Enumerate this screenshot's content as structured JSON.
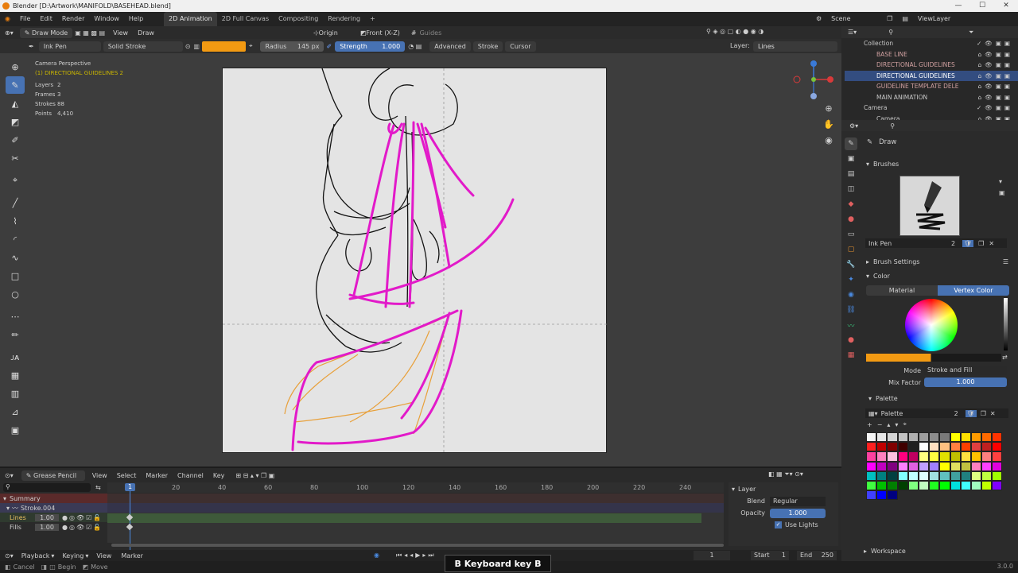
{
  "window": {
    "title": "Blender [D:\\Artwork\\MANIFOLD\\BASEHEAD.blend]",
    "buttons": [
      "—",
      "☐",
      "✕"
    ]
  },
  "menus": [
    "File",
    "Edit",
    "Render",
    "Window",
    "Help"
  ],
  "workspaces": [
    "2D Animation",
    "2D Full Canvas",
    "Compositing",
    "Rendering",
    "+"
  ],
  "scene": {
    "label": "Scene",
    "viewlayer": "ViewLayer"
  },
  "header": {
    "mode": "Draw Mode",
    "view": "View",
    "draw": "Draw",
    "origin": "Origin",
    "view_dir": "Front (X-Z)",
    "guides": "Guides"
  },
  "tool_header": {
    "brush": "Ink Pen",
    "stroke_type": "Solid Stroke",
    "radius_label": "Radius",
    "radius_value": "145 px",
    "strength_label": "Strength",
    "strength_value": "1.000",
    "advanced": "Advanced",
    "stroke": "Stroke",
    "cursor": "Cursor",
    "layer_label": "Layer:",
    "layer_value": "Lines",
    "color": "#f39a12"
  },
  "overlay": {
    "camera": "Camera Perspective",
    "object": "(1) DIRECTIONAL GUIDELINES 2",
    "layers_label": "Layers",
    "layers": "2",
    "frames_label": "Frames",
    "frames": "3",
    "strokes_label": "Strokes",
    "strokes": "88",
    "points_label": "Points",
    "points": "4,410"
  },
  "outliner": {
    "items": [
      {
        "name": "Collection",
        "indent": 0
      },
      {
        "name": "BASE LINE",
        "indent": 1
      },
      {
        "name": "DIRECTIONAL GUIDELINES",
        "indent": 1
      },
      {
        "name": "DIRECTIONAL GUIDELINES",
        "indent": 1,
        "selected": true
      },
      {
        "name": "GUIDELINE TEMPLATE DELE",
        "indent": 1
      },
      {
        "name": "MAIN ANIMATION",
        "indent": 1
      },
      {
        "name": "Camera",
        "indent": 0
      },
      {
        "name": "Camera",
        "indent": 1
      }
    ]
  },
  "properties": {
    "tool": "Draw",
    "brushes_label": "Brushes",
    "brush_name": "Ink Pen",
    "brush_users": "2",
    "brush_settings": "Brush Settings",
    "color_label": "Color",
    "material_tab": "Material",
    "vertex_tab": "Vertex Color",
    "mode_label": "Mode",
    "mode_value": "Stroke and Fill",
    "mix_label": "Mix Factor",
    "mix_value": "1.000",
    "palette_label": "Palette",
    "palette_name": "Palette",
    "palette_users": "2",
    "workspace": "Workspace",
    "swatch_color": "#f39a12"
  },
  "palette_colors": [
    "#f5f5f5",
    "#e6e6e6",
    "#d4d4d4",
    "#c2c2c2",
    "#b0b0b0",
    "#9e9e9e",
    "#8c8c8c",
    "#7a7a7a",
    "#ffff00",
    "#ffe000",
    "#ff9c00",
    "#ff6a00",
    "#ff3300",
    "#ff2020",
    "#c00000",
    "#800000",
    "#400000",
    "#202020",
    "#ffffff",
    "#ffe0c0",
    "#ffc080",
    "#ff8040",
    "#ff4000",
    "#e04040",
    "#c02020",
    "#ff0000",
    "#ff40a0",
    "#ff80c0",
    "#ffc0e0",
    "#ff0080",
    "#c00060",
    "#ffff80",
    "#ffff40",
    "#e0e000",
    "#c0c000",
    "#ffe040",
    "#ffc000",
    "#ff8080",
    "#ff4040",
    "#ff00ff",
    "#c000c0",
    "#800080",
    "#ff80ff",
    "#e060e0",
    "#c0a0ff",
    "#a080ff",
    "#ffff00",
    "#e0e060",
    "#c0c040",
    "#ff80c0",
    "#ff40ff",
    "#e000e0",
    "#00c0c0",
    "#008080",
    "#004040",
    "#80ffff",
    "#c0ffff",
    "#e0ffff",
    "#a0e0e0",
    "#60c0c0",
    "#40a0a0",
    "#208080",
    "#e0ff80",
    "#c0ff40",
    "#a0ff00",
    "#40ff40",
    "#00c000",
    "#008000",
    "#004000",
    "#80ff80",
    "#c0ffc0",
    "#20ff20",
    "#00ff00",
    "#00e0e0",
    "#40ffff",
    "#a0ffc0",
    "#c0ff00",
    "#8000ff",
    "#4040ff",
    "#0000ff",
    "#000080"
  ],
  "timeline": {
    "mode": "Grease Pencil",
    "menus": [
      "View",
      "Select",
      "Marker",
      "Channel",
      "Key"
    ],
    "ticks": [
      "1",
      "20",
      "40",
      "60",
      "80",
      "100",
      "120",
      "140",
      "160",
      "180",
      "200",
      "220",
      "240"
    ],
    "summary": "Summary",
    "object": "Stroke.004",
    "layers": [
      {
        "name": "Lines",
        "opacity": "1.00"
      },
      {
        "name": "Fills",
        "opacity": "1.00"
      }
    ],
    "layer_panel": {
      "title": "Layer",
      "blend_label": "Blend",
      "blend_value": "Regular",
      "opacity_label": "Opacity",
      "opacity_value": "1.000",
      "use_lights": "Use Lights"
    }
  },
  "playback": {
    "playback": "Playback",
    "keying": "Keying",
    "view": "View",
    "marker": "Marker",
    "current": "1",
    "start_label": "Start",
    "start": "1",
    "end_label": "End",
    "end": "250"
  },
  "status": {
    "cancel": "Cancel",
    "begin": "Begin",
    "move": "Move",
    "version": "3.0.0"
  },
  "keyhint": "B Keyboard key B"
}
